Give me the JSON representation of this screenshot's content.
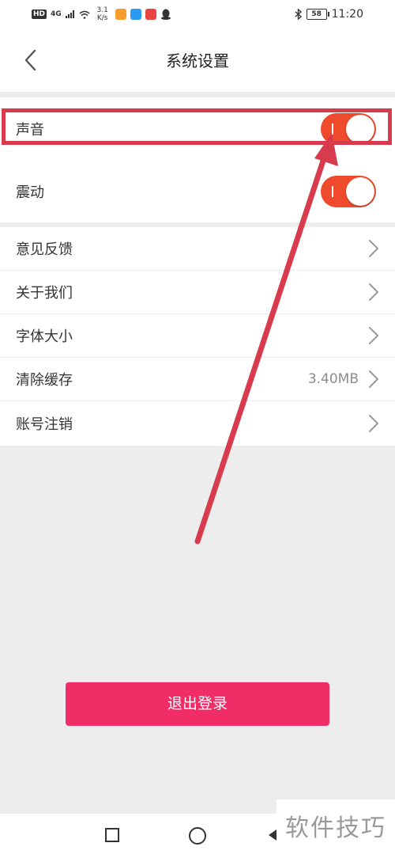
{
  "status_bar": {
    "hd": "HD",
    "net": "4G",
    "speed_value": "3.1",
    "speed_unit": "K/s",
    "battery": "58",
    "time": "11:20",
    "app_icons": [
      "#f59e2b",
      "#2b9af5",
      "#e94343"
    ]
  },
  "header": {
    "back_icon": "chevron-left-icon",
    "title": "系统设置"
  },
  "settings": {
    "sound_label": "声音",
    "sound_on": true,
    "vibration_label": "震动",
    "vibration_on": true,
    "feedback_label": "意见反馈",
    "about_label": "关于我们",
    "font_size_label": "字体大小",
    "clear_cache_label": "清除缓存",
    "cache_size": "3.40MB",
    "account_cancel_label": "账号注销"
  },
  "logout": {
    "label": "退出登录"
  },
  "watermark": "软件技巧",
  "colors": {
    "toggle_on": "#ef4a2b",
    "logout": "#f02d67",
    "annotation": "#d83b4d"
  }
}
